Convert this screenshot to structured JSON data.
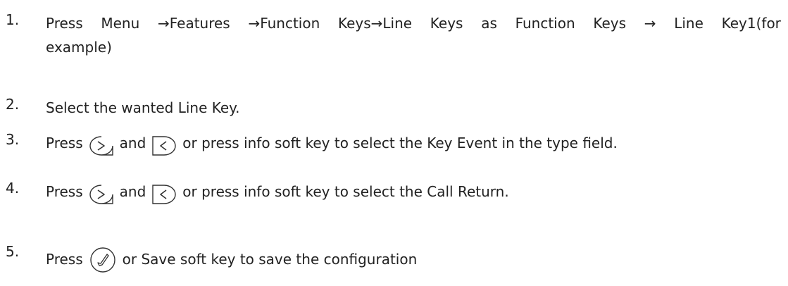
{
  "steps": [
    {
      "number": "1.",
      "line1_words": [
        "Press",
        "Menu",
        "→Features",
        "→Function",
        "Keys→Line",
        "Keys",
        "as",
        "Function",
        "Keys",
        "→",
        "Line",
        "Key1(for"
      ],
      "line2": "example)"
    },
    {
      "number": "2.",
      "text": "Select the wanted Line Key."
    },
    {
      "number": "3.",
      "press": "Press",
      "and": "and",
      "rest": "or press info soft key to select the Key Event in the type field.",
      "keys": [
        "right-arrow-key-icon",
        "left-arrow-key-icon"
      ]
    },
    {
      "number": "4.",
      "press": "Press",
      "and": "and",
      "rest": "or press info soft key to select the Call Return.",
      "keys": [
        "right-arrow-key-icon",
        "left-arrow-key-icon"
      ]
    },
    {
      "number": "5.",
      "press": "Press",
      "rest": "or Save soft key to save the configuration",
      "keys": [
        "ok-key-icon"
      ]
    }
  ]
}
